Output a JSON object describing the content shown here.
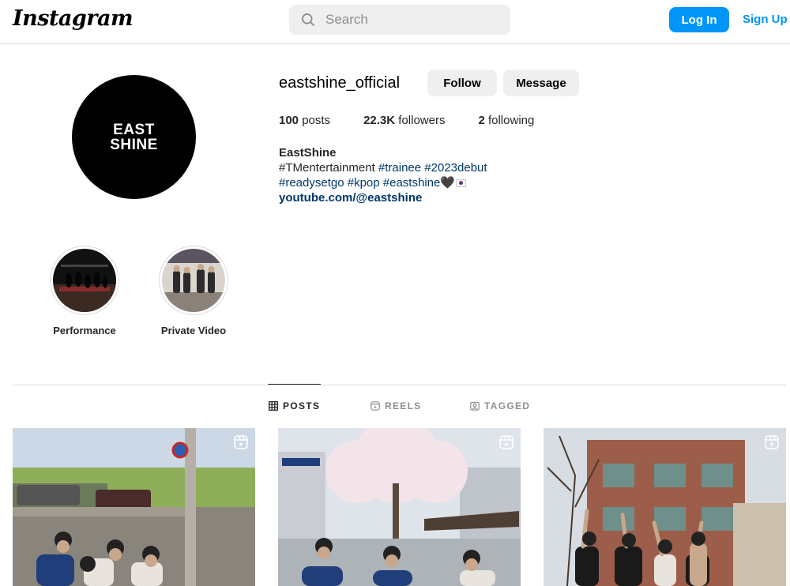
{
  "header": {
    "logo": "Instagram",
    "search_placeholder": "Search",
    "login_label": "Log In",
    "signup_label": "Sign Up"
  },
  "profile": {
    "avatar_text_line1": "EAST",
    "avatar_text_line2": "SHINE",
    "username": "eastshine_official",
    "follow_label": "Follow",
    "message_label": "Message",
    "posts_count": "100",
    "posts_label": "posts",
    "followers_count": "22.3K",
    "followers_label": "followers",
    "following_count": "2",
    "following_label": "following",
    "display_name": "EastShine",
    "bio_line1_prefix": "#TMentertainment",
    "bio_line1_tag1": "#trainee",
    "bio_line1_tag2": "#2023debut",
    "bio_line2_tag1": "#readysetgo",
    "bio_line2_tag2": "#kpop",
    "bio_line2_tag3": "#eastshine",
    "bio_heart": "🖤",
    "link": "youtube.com/@eastshine"
  },
  "highlights": [
    {
      "label": "Performance"
    },
    {
      "label": "Private Video"
    }
  ],
  "tabs": [
    {
      "label": "POSTS",
      "active": true
    },
    {
      "label": "REELS",
      "active": false
    },
    {
      "label": "TAGGED",
      "active": false
    }
  ],
  "posts": [
    {
      "type": "reel",
      "icon": "reel-icon"
    },
    {
      "type": "reel",
      "icon": "reel-icon"
    },
    {
      "type": "reel",
      "icon": "reel-icon"
    }
  ],
  "colors": {
    "accent": "#0095f6",
    "hashtag": "#00376b",
    "border": "#dbdbdb",
    "button_grey": "#efefef"
  }
}
